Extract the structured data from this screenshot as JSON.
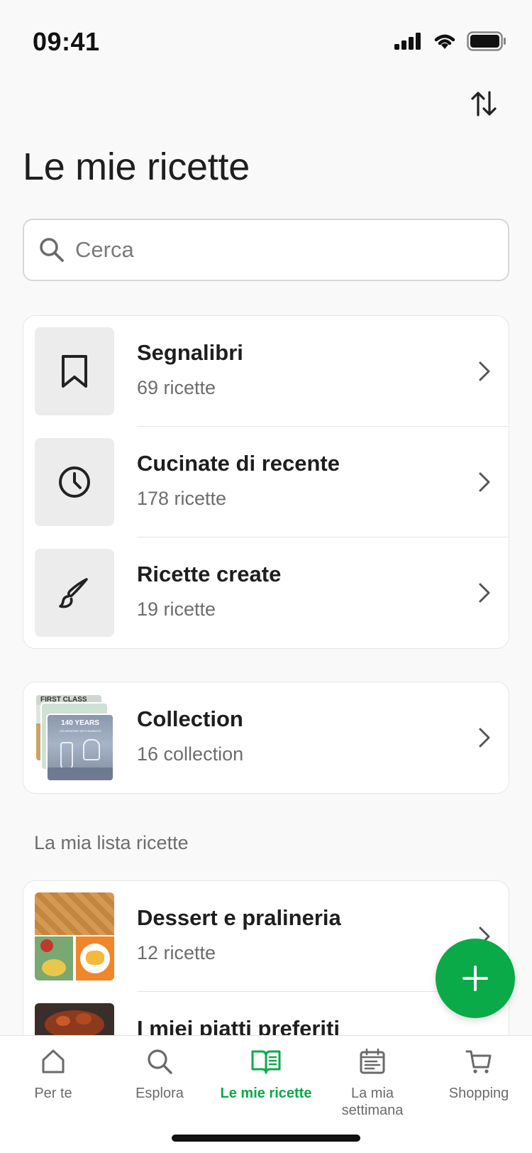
{
  "status_bar": {
    "time": "09:41"
  },
  "header": {
    "title": "Le mie ricette",
    "sort_icon": "sort-arrows-icon"
  },
  "search": {
    "placeholder": "Cerca"
  },
  "library": [
    {
      "title": "Segnalibri",
      "subtitle": "69 ricette",
      "icon": "bookmark-icon"
    },
    {
      "title": "Cucinate di recente",
      "subtitle": "178 ricette",
      "icon": "clock-icon"
    },
    {
      "title": "Ricette create",
      "subtitle": "19 ricette",
      "icon": "brush-icon"
    }
  ],
  "collection": {
    "title": "Collection",
    "subtitle": "16 collection",
    "thumb_text_1": "FIRST CLASS",
    "thumb_text_2": "140 YEARS",
    "thumb_text_3": "CELEBRATING WITH BUBBLES"
  },
  "section_label": "La mia lista ricette",
  "lists": [
    {
      "title": "Dessert e pralineria",
      "subtitle": "12 ricette"
    },
    {
      "title": "I miei piatti preferiti",
      "subtitle": ""
    }
  ],
  "tabs": [
    {
      "label": "Per te",
      "icon": "home-icon",
      "active": false
    },
    {
      "label": "Esplora",
      "icon": "search-icon",
      "active": false
    },
    {
      "label": "Le mie ricette",
      "icon": "open-book-icon",
      "active": true
    },
    {
      "label": "La mia settimana",
      "icon": "calendar-icon",
      "active": false
    },
    {
      "label": "Shopping",
      "icon": "cart-icon",
      "active": false
    }
  ],
  "colors": {
    "accent": "#0aaa48",
    "background": "#f9f9f9",
    "text": "#1e1e1e",
    "muted": "#6d6d6d"
  }
}
